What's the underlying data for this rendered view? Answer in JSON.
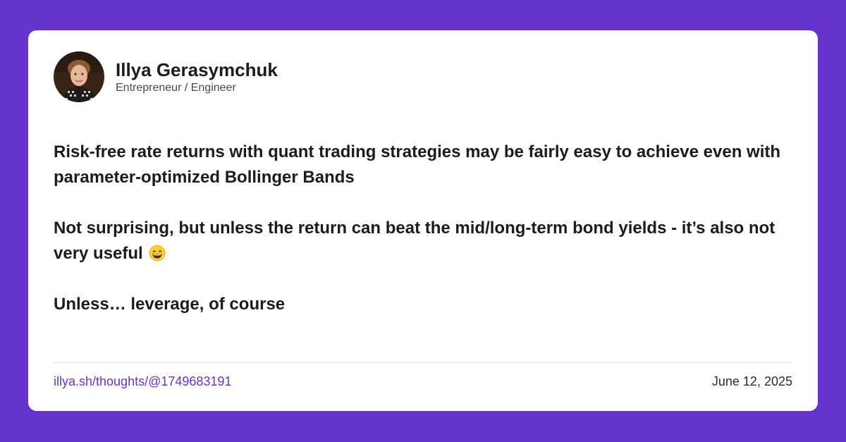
{
  "author": {
    "name": "Illya Gerasymchuk",
    "role": "Entrepreneur / Engineer"
  },
  "post": {
    "paragraphs": [
      "Risk-free rate returns with quant trading strategies may be fairly easy to achieve even with parameter-optimized Bollinger Bands",
      "Not surprising, but unless the return can beat the mid/long-term bond yields - it’s also not very useful",
      "Unless… leverage, of course"
    ],
    "emoji": "grinning-face-with-smiling-eyes"
  },
  "footer": {
    "link": "illya.sh/thoughts/@1749683191",
    "date": "June 12, 2025"
  },
  "colors": {
    "background": "#6633cc",
    "card": "#ffffff",
    "link": "#6633cc"
  }
}
